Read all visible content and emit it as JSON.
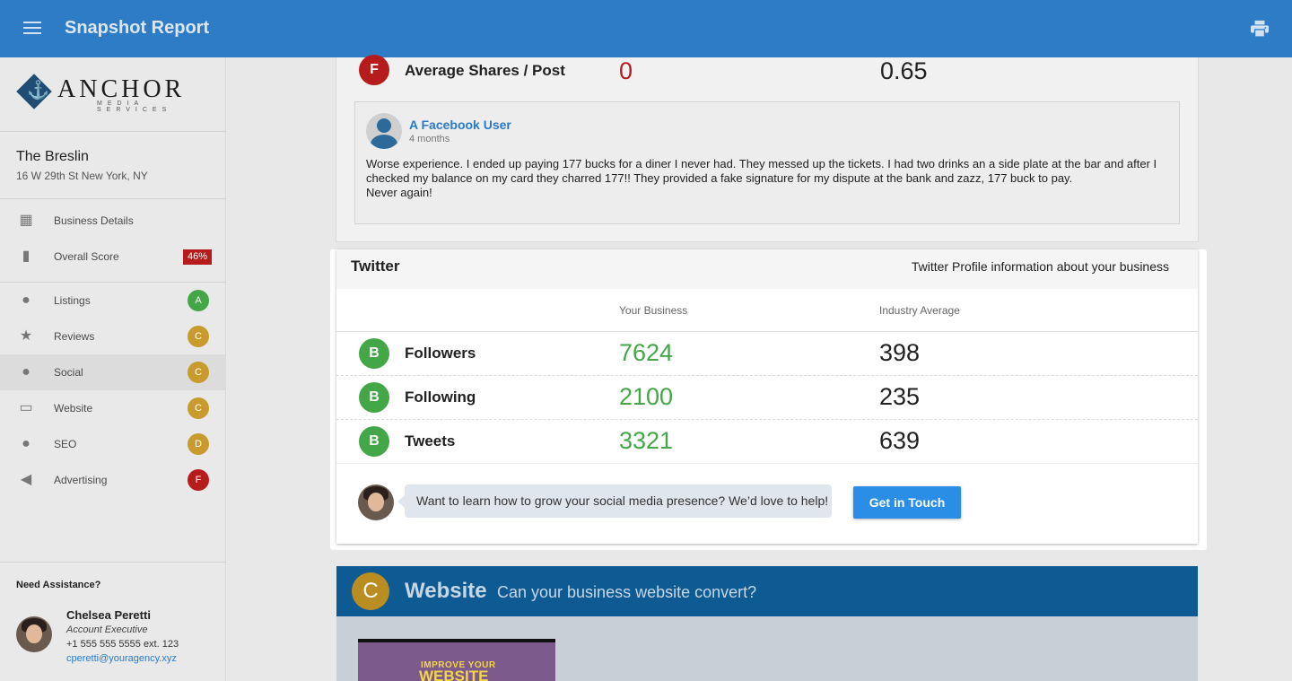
{
  "header": {
    "title": "Snapshot Report",
    "menu_icon": "hamburger-menu-icon",
    "print_icon": "print-icon"
  },
  "brand": {
    "name": "ANCHOR",
    "tagline": "MEDIA SERVICES"
  },
  "business": {
    "name": "The Breslin",
    "address": "16 W 29th St New York, NY"
  },
  "nav": {
    "business_details": "Business Details",
    "overall_score": "Overall Score",
    "overall_pct": "46%",
    "items": [
      {
        "label": "Listings",
        "grade": "A",
        "color": "#43a647"
      },
      {
        "label": "Reviews",
        "grade": "C",
        "color": "#c99b2c"
      },
      {
        "label": "Social",
        "grade": "C",
        "color": "#c99b2c"
      },
      {
        "label": "Website",
        "grade": "C",
        "color": "#c99b2c"
      },
      {
        "label": "SEO",
        "grade": "D",
        "color": "#c99b2c"
      },
      {
        "label": "Advertising",
        "grade": "F",
        "color": "#b71c1c"
      }
    ]
  },
  "assistance": {
    "heading": "Need Assistance?",
    "name": "Chelsea Peretti",
    "role": "Account Executive",
    "phone": "+1 555 555 5555 ext. 123",
    "email": "cperetti@youragency.xyz"
  },
  "facebook": {
    "shares_grade": "F",
    "shares_label": "Average Shares / Post",
    "shares_yours": "0",
    "shares_industry": "0.65",
    "review": {
      "user": "A Facebook User",
      "when": "4 months",
      "text": "Worse experience. I ended up paying 177 bucks for a diner I never had. They messed up the tickets. I had two drinks an a side plate at the bar and after I checked my balance on my card they charred 177!! They provided a fake signature for my dispute at the bank and zazz, 177 buck to pay.",
      "text2": "Never again!"
    }
  },
  "twitter": {
    "title": "Twitter",
    "description": "Twitter Profile information about your business",
    "col_yours": "Your Business",
    "col_industry": "Industry Average",
    "rows": [
      {
        "grade": "B",
        "label": "Followers",
        "yours": "7624",
        "industry": "398"
      },
      {
        "grade": "B",
        "label": "Following",
        "yours": "2100",
        "industry": "235"
      },
      {
        "grade": "B",
        "label": "Tweets",
        "yours": "3321",
        "industry": "639"
      }
    ],
    "prompt": "Want to learn how to grow your social media presence? We’d love to help!",
    "cta": "Get in Touch"
  },
  "website": {
    "grade": "C",
    "title": "Website",
    "subtitle": "Can your business website convert?",
    "image_line1": "IMPROVE YOUR",
    "image_line2": "WEBSITE"
  }
}
